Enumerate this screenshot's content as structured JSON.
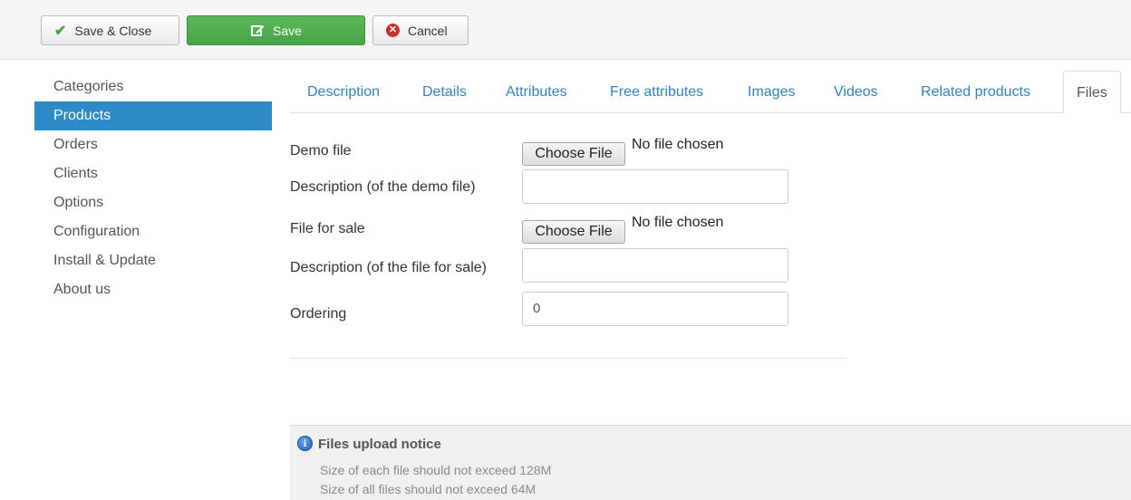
{
  "toolbar": {
    "save_close_label": "Save & Close",
    "save_label": "Save",
    "cancel_label": "Cancel"
  },
  "sidebar": {
    "items": [
      {
        "label": "Categories"
      },
      {
        "label": "Products",
        "active": true
      },
      {
        "label": "Orders"
      },
      {
        "label": "Clients"
      },
      {
        "label": "Options"
      },
      {
        "label": "Configuration"
      },
      {
        "label": "Install & Update"
      },
      {
        "label": "About us"
      }
    ]
  },
  "tabs": [
    {
      "label": "Description"
    },
    {
      "label": "Details"
    },
    {
      "label": "Attributes"
    },
    {
      "label": "Free attributes"
    },
    {
      "label": "Images"
    },
    {
      "label": "Videos"
    },
    {
      "label": "Related products"
    },
    {
      "label": "Files",
      "active": true
    }
  ],
  "form": {
    "demo_file_label": "Demo file",
    "demo_file_button": "Choose File",
    "demo_file_status": "No file chosen",
    "demo_desc_label": "Description (of the demo file)",
    "demo_desc_value": "",
    "sale_file_label": "File for sale",
    "sale_file_button": "Choose File",
    "sale_file_status": "No file chosen",
    "sale_desc_label": "Description (of the file for sale)",
    "sale_desc_value": "",
    "ordering_label": "Ordering",
    "ordering_value": "0"
  },
  "notice": {
    "title": "Files upload notice",
    "line1": "Size of each file should not exceed 128M",
    "line2": "Size of all files should not exceed 64M"
  },
  "colors": {
    "accent": "#2d8ac7",
    "save_green": "#5cb85c",
    "link": "#2f84c1",
    "cancel_red": "#c7302b"
  }
}
